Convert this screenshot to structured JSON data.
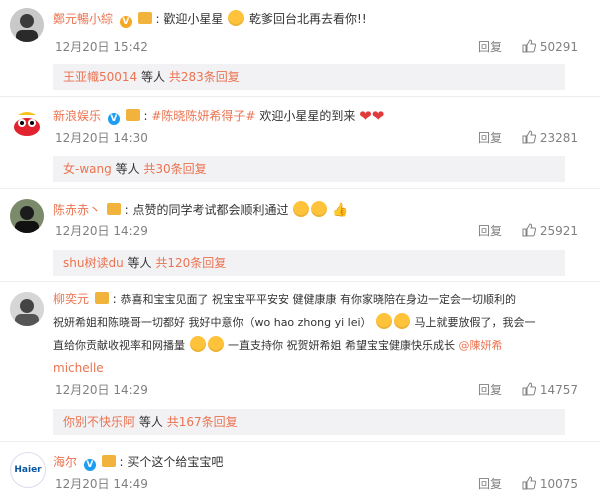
{
  "comments": [
    {
      "user": "鄭元暢小綜",
      "text": "歡迎小星星",
      "text2": "乾爹回台北再去看你!!",
      "time": "12月20日 15:42",
      "reply_label": "回复",
      "likes": "50291",
      "sub": {
        "name": "王亚幟50014",
        "mid": "等人",
        "count": "共283条回复"
      }
    },
    {
      "user": "新浪娱乐",
      "topic": "#陈晓陈妍希得子#",
      "text": "欢迎小星星的到来",
      "time": "12月20日 14:30",
      "reply_label": "回复",
      "likes": "23281",
      "sub": {
        "name": "女-wang",
        "mid": "等人",
        "count": "共30条回复"
      }
    },
    {
      "user": "陈赤赤丶",
      "text": "点赞的同学考试都会顺利通过",
      "time": "12月20日 14:29",
      "reply_label": "回复",
      "likes": "25921",
      "sub": {
        "name": "shu树读du",
        "mid": "等人",
        "count": "共120条回复"
      }
    },
    {
      "user": "柳奕元",
      "line1": "恭喜和宝宝见面了 祝宝宝平平安安 健健康康 有你家晓陪在身边一定会一切顺利的",
      "line2a": "祝妍希姐和陈晓哥一切都好 我好中意你（wo hao zhong yi lei）",
      "line2b": "马上就要放假了，我会一",
      "line3a": "直给你贡献收视率和网播量",
      "line3b": "一直支持你 祝贺妍希姐 希望宝宝健康快乐成长",
      "mention": "@陳妍希",
      "line4": "michelle",
      "time": "12月20日 14:29",
      "reply_label": "回复",
      "likes": "14757",
      "sub": {
        "name": "你别不快乐阿",
        "mid": "等人",
        "count": "共167条回复"
      }
    },
    {
      "user": "海尔",
      "text": "买个这个给宝宝吧",
      "time": "12月20日 14:49",
      "reply_label": "回复",
      "likes": "10075",
      "brand": "Haier"
    }
  ],
  "colors": {
    "username": "#eb7350",
    "meta": "#808080",
    "subbox_bg": "#f2f2f5"
  },
  "icons": {
    "like": "thumb-up-icon",
    "verified": "verified-v-icon"
  }
}
